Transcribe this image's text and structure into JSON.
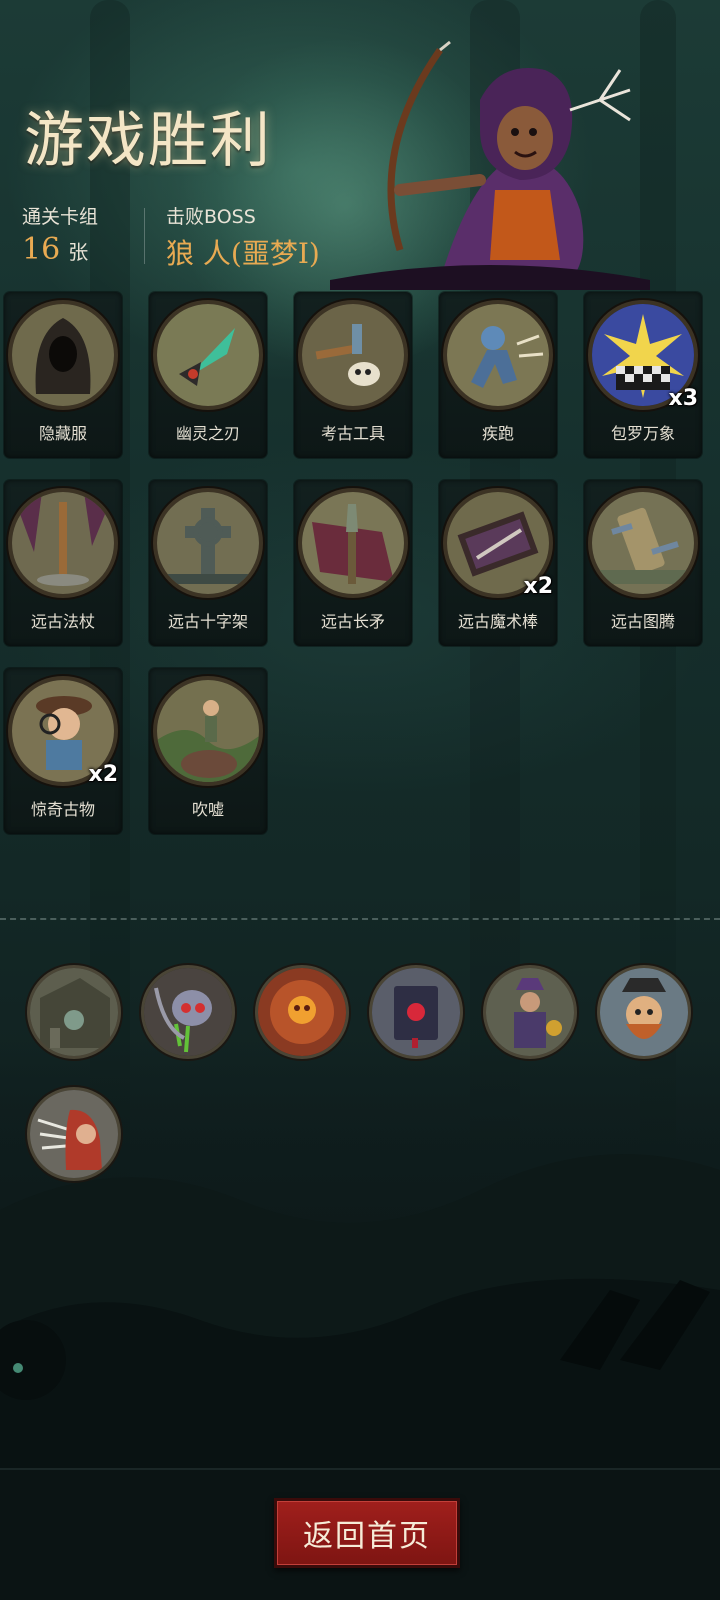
{
  "header": {
    "title": "游戏胜利",
    "deck_label": "通关卡组",
    "deck_count": "16",
    "deck_unit": "张",
    "boss_label": "击败BOSS",
    "boss_name": "狼 人(噩梦I)"
  },
  "cards": [
    {
      "name": "隐藏服",
      "icon": "hooded-cloak-icon",
      "count": ""
    },
    {
      "name": "幽灵之刃",
      "icon": "ghost-blade-icon",
      "count": ""
    },
    {
      "name": "考古工具",
      "icon": "archaeology-tools-icon",
      "count": ""
    },
    {
      "name": "疾跑",
      "icon": "sprint-icon",
      "count": ""
    },
    {
      "name": "包罗万象",
      "icon": "all-encompassing-icon",
      "count": "x3"
    },
    {
      "name": "远古法杖",
      "icon": "ancient-staff-icon",
      "count": ""
    },
    {
      "name": "远古十字架",
      "icon": "ancient-cross-icon",
      "count": ""
    },
    {
      "name": "远古长矛",
      "icon": "ancient-spear-icon",
      "count": ""
    },
    {
      "name": "远古魔术棒",
      "icon": "ancient-wand-icon",
      "count": "x2"
    },
    {
      "name": "远古图腾",
      "icon": "ancient-totem-icon",
      "count": ""
    },
    {
      "name": "惊奇古物",
      "icon": "amazing-relic-icon",
      "count": "x2"
    },
    {
      "name": "吹嘘",
      "icon": "boast-icon",
      "count": ""
    }
  ],
  "relics": [
    {
      "icon": "ruins-relic-icon"
    },
    {
      "icon": "poison-skull-relic-icon"
    },
    {
      "icon": "skull-plate-relic-icon"
    },
    {
      "icon": "red-tome-relic-icon"
    },
    {
      "icon": "sorcerer-relic-icon"
    },
    {
      "icon": "pirate-relic-icon"
    },
    {
      "icon": "red-hood-relic-icon"
    }
  ],
  "footer": {
    "home_button": "返回首页"
  },
  "colors": {
    "accent_gold": "#e8aa52",
    "button_red": "#8f1b18",
    "title_cream": "#f4e6c6"
  }
}
